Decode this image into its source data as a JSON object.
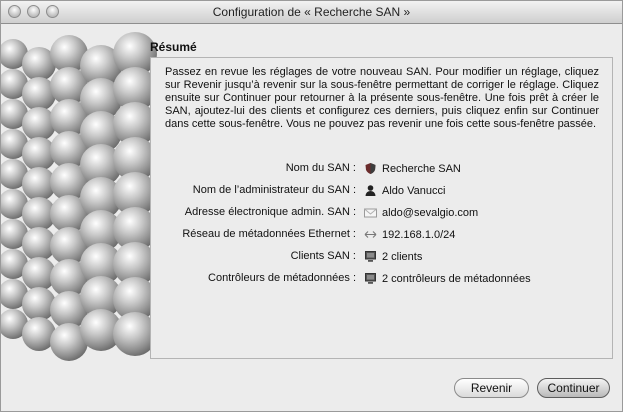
{
  "window": {
    "title": "Configuration de « Recherche SAN »"
  },
  "summary": {
    "heading": "Résumé",
    "intro": "Passez en revue les réglages de votre nouveau SAN. Pour modifier un réglage, cliquez sur Revenir jusqu’à revenir sur la sous-fenêtre permettant de corriger le réglage. Cliquez ensuite sur Continuer pour retourner à la présente sous-fenêtre. Une fois prêt à créer le SAN, ajoutez-lui des clients et configurez ces derniers, puis cliquez enfin sur Continuer dans cette sous-fenêtre. Vous ne pouvez pas revenir une fois cette sous-fenêtre passée.",
    "rows": [
      {
        "label": "Nom du SAN :",
        "value": "Recherche SAN",
        "icon": "san-shield-icon"
      },
      {
        "label": "Nom de l’administrateur du SAN :",
        "value": "Aldo Vanucci",
        "icon": "user-icon"
      },
      {
        "label": "Adresse électronique admin. SAN :",
        "value": "aldo@sevalgio.com",
        "icon": "mail-icon"
      },
      {
        "label": "Réseau de métadonnées Ethernet :",
        "value": "192.168.1.0/24",
        "icon": "network-arrows-icon"
      },
      {
        "label": "Clients SAN :",
        "value": "2 clients",
        "icon": "computer-icon"
      },
      {
        "label": "Contrôleurs de métadonnées :",
        "value": "2 contrôleurs de métadonnées",
        "icon": "computer-icon"
      }
    ]
  },
  "buttons": {
    "back": "Revenir",
    "continue": "Continuer"
  }
}
